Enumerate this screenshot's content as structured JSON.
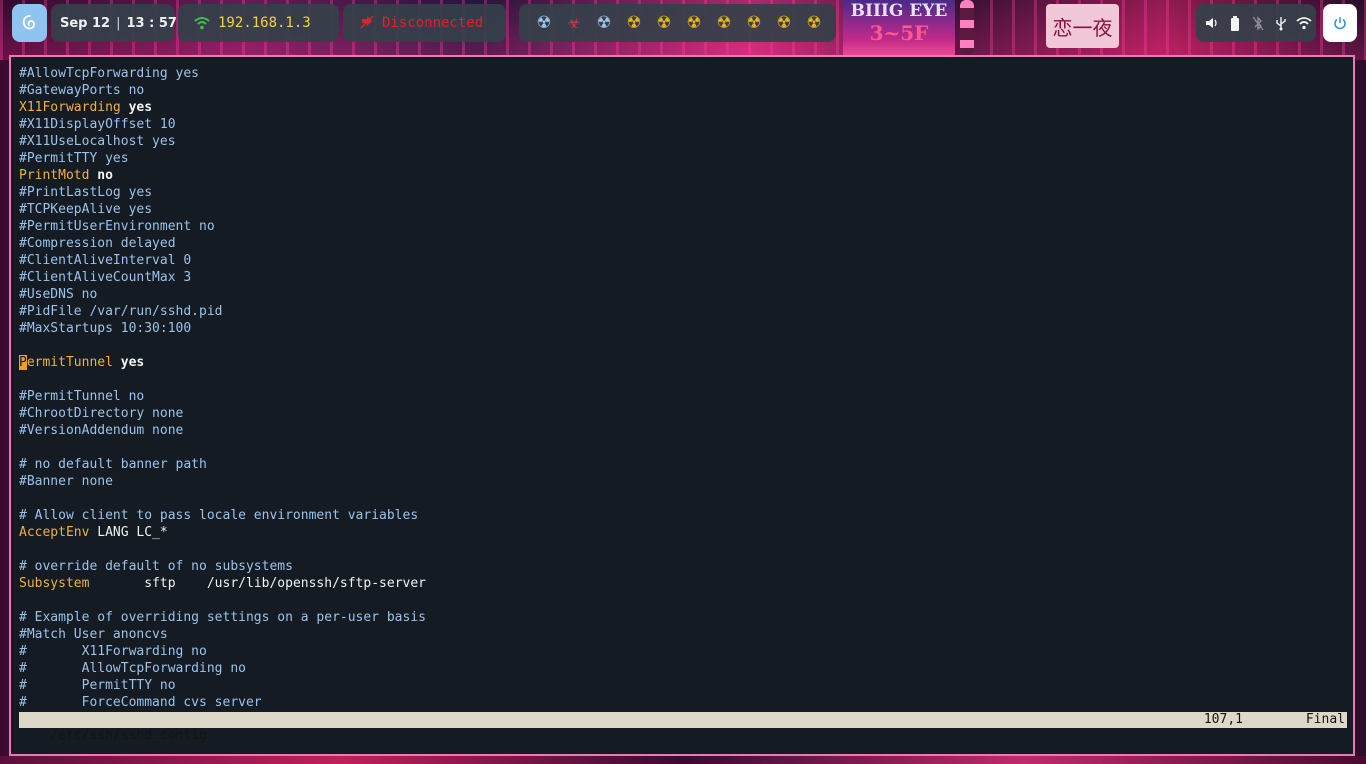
{
  "topbar": {
    "date": "Sep 12",
    "time": "13 : 57",
    "ip": "192.168.1.3",
    "vpn_status": "Disconnected",
    "workspaces": [
      {
        "glyph": "☢",
        "color": "blue"
      },
      {
        "glyph": "☣",
        "color": "red"
      },
      {
        "glyph": "☢",
        "color": "blue"
      },
      {
        "glyph": "☢",
        "color": "yellow"
      },
      {
        "glyph": "☢",
        "color": "yellow"
      },
      {
        "glyph": "☢",
        "color": "yellow"
      },
      {
        "glyph": "☢",
        "color": "yellow"
      },
      {
        "glyph": "☢",
        "color": "yellow"
      },
      {
        "glyph": "☢",
        "color": "yellow"
      },
      {
        "glyph": "☢",
        "color": "yellow"
      }
    ],
    "billboard_text": "BIIIG EYE",
    "billboard_sub": "3~5F",
    "sign_text": "恋一夜",
    "tray": [
      "volume-icon",
      "battery-icon",
      "bluetooth-off-icon",
      "usb-icon",
      "wifi-icon"
    ]
  },
  "editor": {
    "lines": [
      [
        {
          "t": "#AllowTcpForwarding yes",
          "s": "c"
        }
      ],
      [
        {
          "t": "#GatewayPorts no",
          "s": "c"
        }
      ],
      [
        {
          "t": "X11Forwarding",
          "s": "k"
        },
        {
          "t": " ",
          "s": "t"
        },
        {
          "t": "yes",
          "s": "v"
        }
      ],
      [
        {
          "t": "#X11DisplayOffset 10",
          "s": "c"
        }
      ],
      [
        {
          "t": "#X11UseLocalhost yes",
          "s": "c"
        }
      ],
      [
        {
          "t": "#PermitTTY yes",
          "s": "c"
        }
      ],
      [
        {
          "t": "PrintMotd",
          "s": "k"
        },
        {
          "t": " ",
          "s": "t"
        },
        {
          "t": "no",
          "s": "v"
        }
      ],
      [
        {
          "t": "#PrintLastLog yes",
          "s": "c"
        }
      ],
      [
        {
          "t": "#TCPKeepAlive yes",
          "s": "c"
        }
      ],
      [
        {
          "t": "#PermitUserEnvironment no",
          "s": "c"
        }
      ],
      [
        {
          "t": "#Compression delayed",
          "s": "c"
        }
      ],
      [
        {
          "t": "#ClientAliveInterval 0",
          "s": "c"
        }
      ],
      [
        {
          "t": "#ClientAliveCountMax 3",
          "s": "c"
        }
      ],
      [
        {
          "t": "#UseDNS no",
          "s": "c"
        }
      ],
      [
        {
          "t": "#PidFile /var/run/sshd.pid",
          "s": "c"
        }
      ],
      [
        {
          "t": "#MaxStartups 10:30:100",
          "s": "c"
        }
      ],
      [],
      [
        {
          "t": "P",
          "s": "cur"
        },
        {
          "t": "ermitTunnel",
          "s": "k"
        },
        {
          "t": " ",
          "s": "t"
        },
        {
          "t": "yes",
          "s": "v"
        }
      ],
      [],
      [
        {
          "t": "#PermitTunnel no",
          "s": "c"
        }
      ],
      [
        {
          "t": "#ChrootDirectory none",
          "s": "c"
        }
      ],
      [
        {
          "t": "#VersionAddendum none",
          "s": "c"
        }
      ],
      [],
      [
        {
          "t": "# no default banner path",
          "s": "c"
        }
      ],
      [
        {
          "t": "#Banner none",
          "s": "c"
        }
      ],
      [],
      [
        {
          "t": "# Allow client to pass locale environment variables",
          "s": "c"
        }
      ],
      [
        {
          "t": "AcceptEnv",
          "s": "k"
        },
        {
          "t": " LANG LC_*",
          "s": "t"
        }
      ],
      [],
      [
        {
          "t": "# override default of no subsystems",
          "s": "c"
        }
      ],
      [
        {
          "t": "Subsystem",
          "s": "k"
        },
        {
          "t": "       sftp    /usr/lib/openssh/sftp-server",
          "s": "t"
        }
      ],
      [],
      [
        {
          "t": "# Example of overriding settings on a per-user basis",
          "s": "c"
        }
      ],
      [
        {
          "t": "#Match User anoncvs",
          "s": "c"
        }
      ],
      [
        {
          "t": "#       X11Forwarding no",
          "s": "c"
        }
      ],
      [
        {
          "t": "#       AllowTcpForwarding no",
          "s": "c"
        }
      ],
      [
        {
          "t": "#       PermitTTY no",
          "s": "c"
        }
      ],
      [
        {
          "t": "#       ForceCommand cvs server",
          "s": "c"
        }
      ]
    ],
    "status": {
      "file": "/etc/ssh/sshd_config",
      "position": "107,1",
      "scroll": "Final"
    }
  }
}
